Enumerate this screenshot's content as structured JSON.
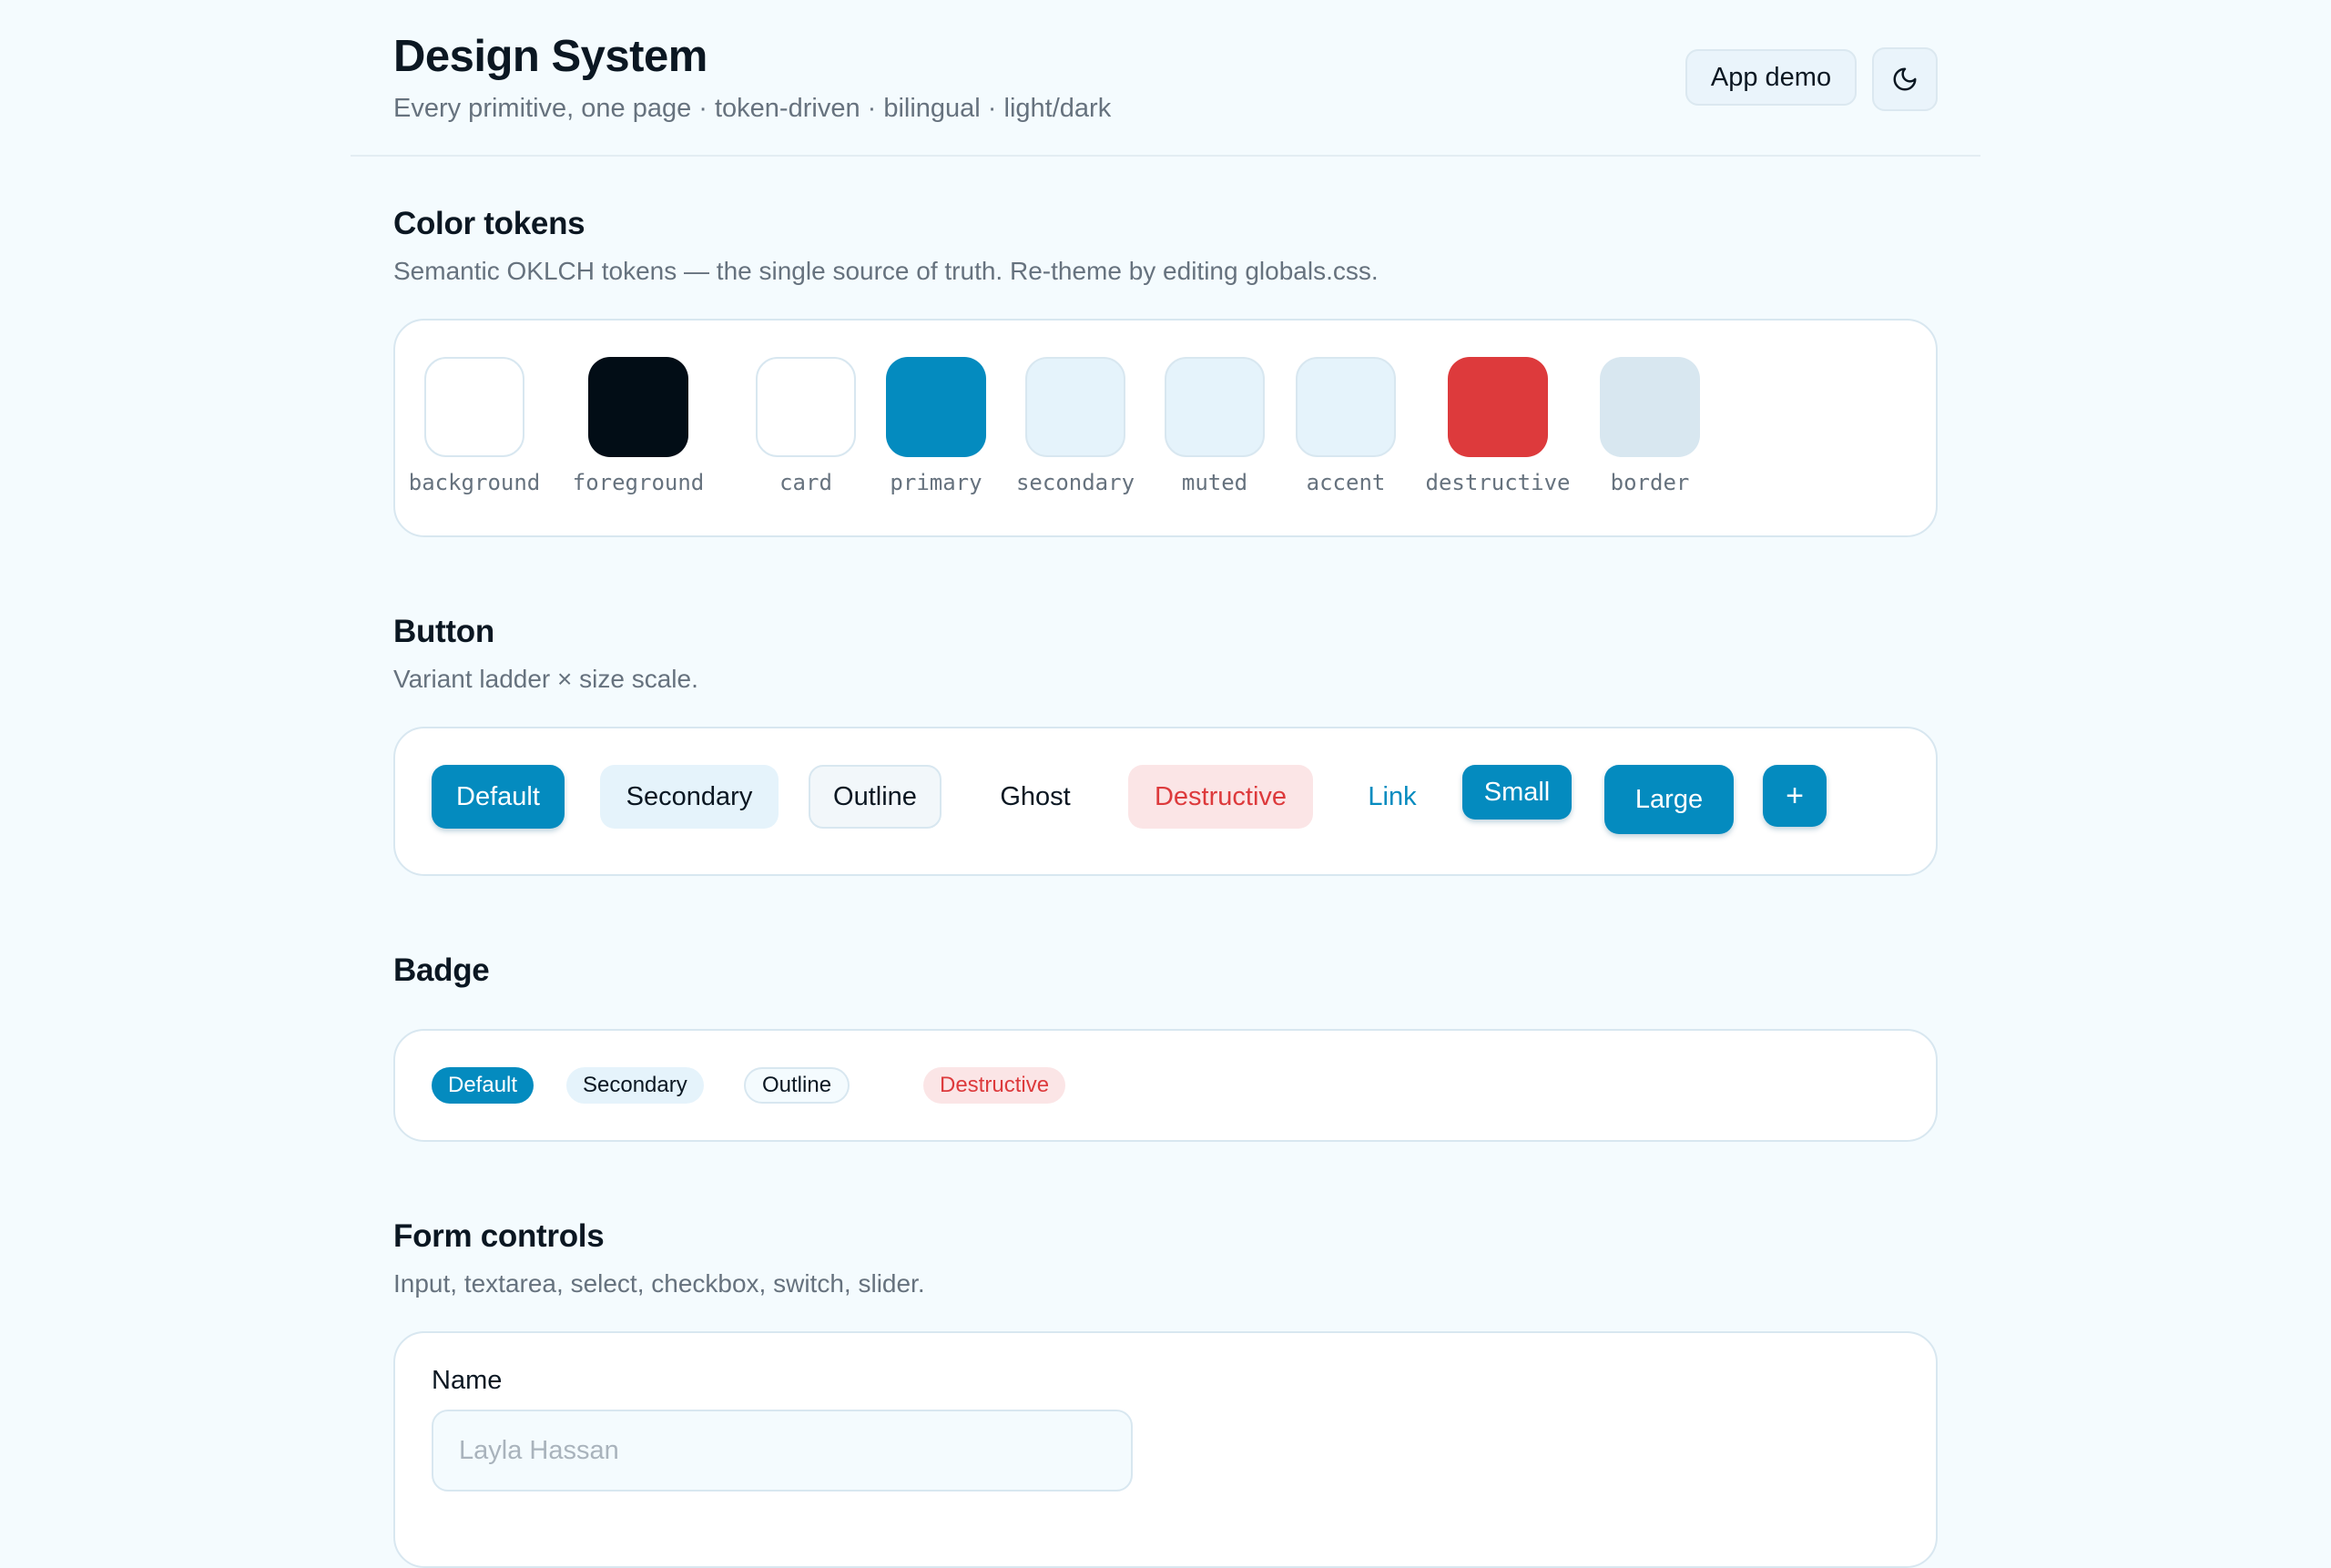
{
  "header": {
    "title": "Design System",
    "subtitle": "Every primitive, one page · token-driven · bilingual · light/dark",
    "app_demo_label": "App demo",
    "theme_icon": "moon-icon"
  },
  "color_tokens": {
    "title": "Color tokens",
    "description": "Semantic OKLCH tokens — the single source of truth. Re-theme by editing globals.css.",
    "swatches": [
      {
        "name": "background",
        "color": "#f4fbfe"
      },
      {
        "name": "foreground",
        "color": "#020d16"
      },
      {
        "name": "card",
        "color": "#ffffff"
      },
      {
        "name": "primary",
        "color": "#048bbf"
      },
      {
        "name": "secondary",
        "color": "#e5f3fb"
      },
      {
        "name": "muted",
        "color": "#e5f3fb"
      },
      {
        "name": "accent",
        "color": "#e5f3fb"
      },
      {
        "name": "destructive",
        "color": "#dd3a3c"
      },
      {
        "name": "border",
        "color": "#d8e7f0"
      }
    ]
  },
  "buttons": {
    "title": "Button",
    "description": "Variant ladder × size scale.",
    "default": "Default",
    "secondary": "Secondary",
    "outline": "Outline",
    "ghost": "Ghost",
    "destructive": "Destructive",
    "link": "Link",
    "small": "Small",
    "large": "Large",
    "icon": "+"
  },
  "badges": {
    "title": "Badge",
    "default": "Default",
    "secondary": "Secondary",
    "outline": "Outline",
    "destructive": "Destructive"
  },
  "form_controls": {
    "title": "Form controls",
    "description": "Input, textarea, select, checkbox, switch, slider.",
    "name_label": "Name",
    "name_placeholder": "Layla Hassan"
  },
  "colors": {
    "primary": "#048bbf",
    "destructive": "#dd3a3c",
    "muted_text": "#66727e"
  }
}
